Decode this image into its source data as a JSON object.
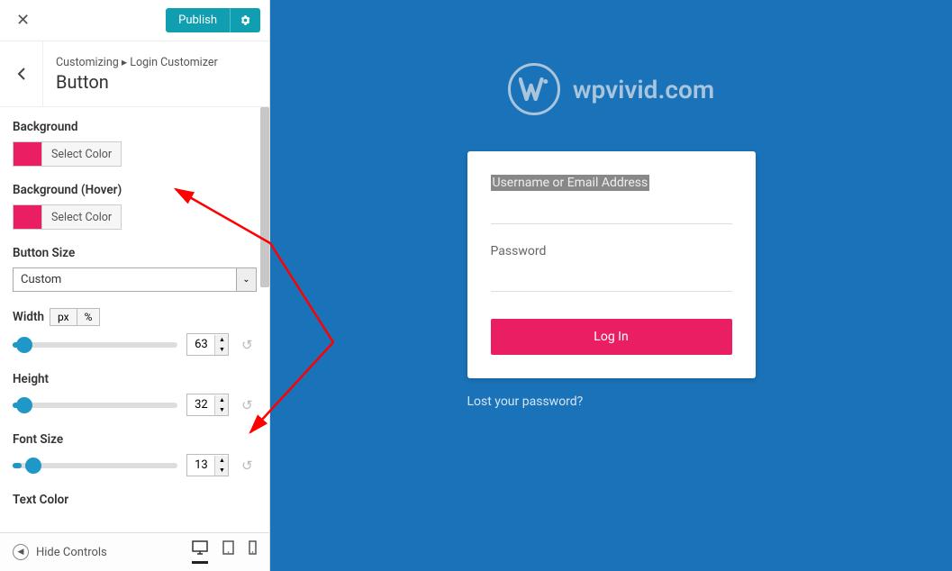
{
  "header": {
    "publish_label": "Publish"
  },
  "breadcrumb": {
    "line": "Customizing ▸ Login Customizer",
    "title": "Button"
  },
  "fields": {
    "bg_label": "Background",
    "bg_hover_label": "Background (Hover)",
    "select_color_label": "Select Color",
    "size_label": "Button Size",
    "size_value": "Custom",
    "width_label": "Width",
    "unit_px": "px",
    "unit_pct": "%",
    "width_value": "63",
    "height_label": "Height",
    "height_value": "32",
    "font_size_label": "Font Size",
    "font_size_value": "13",
    "text_color_label": "Text Color"
  },
  "footer": {
    "hide_controls_label": "Hide Controls"
  },
  "preview": {
    "logo_text": "wpvivid.com",
    "username_label": "Username or Email Address",
    "password_label": "Password",
    "login_button_label": "Log In",
    "lost_password_label": "Lost your password?"
  },
  "colors": {
    "accent_pink": "#e91e63",
    "teal": "#0f9fb0",
    "preview_bg": "#1a72b8"
  }
}
